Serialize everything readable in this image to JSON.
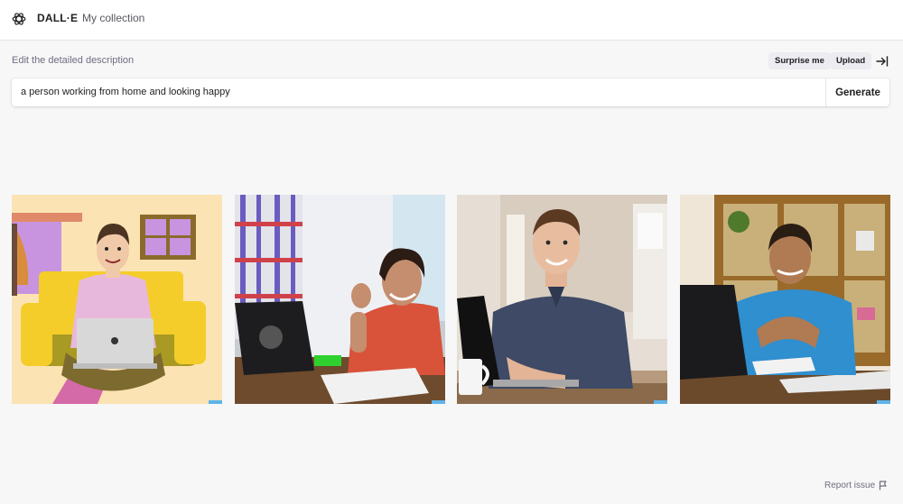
{
  "header": {
    "brand": "DALL·E",
    "nav_collection": "My collection",
    "logo_icon": "openai-logo-icon"
  },
  "prompt": {
    "label": "Edit the detailed description",
    "value": "a person working from home and looking happy",
    "generate_label": "Generate",
    "surprise_label": "Surprise me",
    "upload_label": "Upload",
    "collapse_icon": "arrow-to-right-icon"
  },
  "results": [
    {
      "style": "cartoon illustration"
    },
    {
      "style": "photo"
    },
    {
      "style": "photo"
    },
    {
      "style": "photo"
    }
  ],
  "footer": {
    "report_label": "Report issue",
    "report_icon": "flag-icon"
  }
}
